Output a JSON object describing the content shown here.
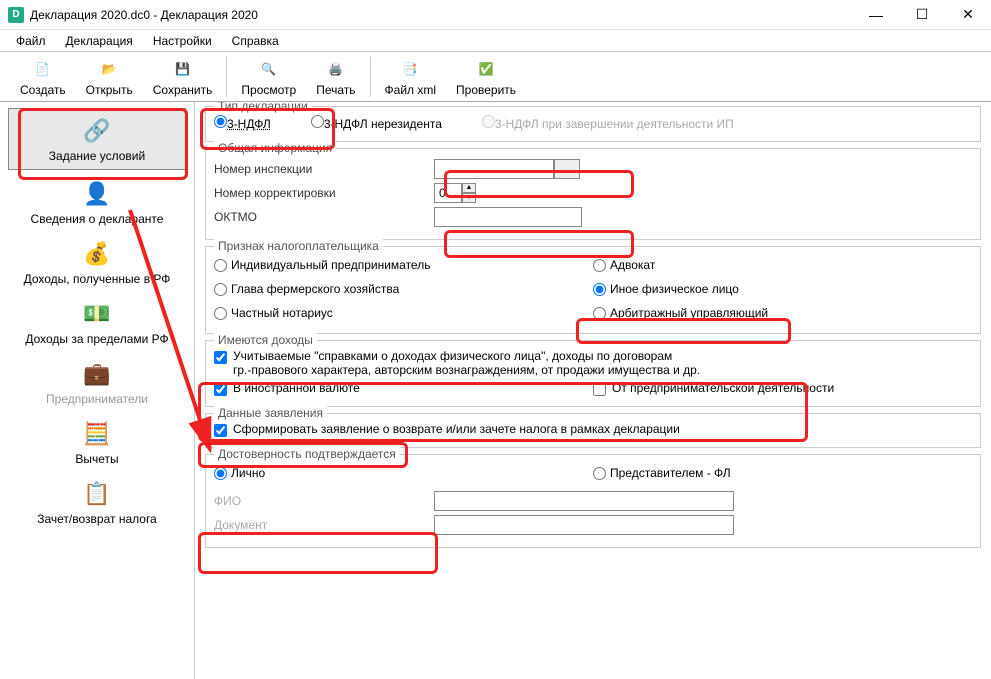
{
  "window": {
    "title": "Декларация 2020.dc0 - Декларация 2020"
  },
  "menu": {
    "file": "Файл",
    "decl": "Декларация",
    "settings": "Настройки",
    "help": "Справка"
  },
  "toolbar": {
    "create": "Создать",
    "open": "Открыть",
    "save": "Сохранить",
    "preview": "Просмотр",
    "print": "Печать",
    "xml": "Файл xml",
    "check": "Проверить"
  },
  "sidebar": {
    "s0": "Задание условий",
    "s1": "Сведения о декларанте",
    "s2": "Доходы, полученные в РФ",
    "s3": "Доходы за пределами РФ",
    "s4": "Предприниматели",
    "s5": "Вычеты",
    "s6": "Зачет/возврат налога"
  },
  "decltype": {
    "legend": "Тип декларации",
    "r1": "3-НДФЛ",
    "r2": "3-НДФЛ нерезидента",
    "r3": "3-НДФЛ при завершении деятельности ИП"
  },
  "general": {
    "legend": "Общая информация",
    "inspection": "Номер инспекции",
    "correction": "Номер корректировки",
    "correction_val": "0",
    "oktmo": "ОКТМО"
  },
  "taxpayer": {
    "legend": "Признак налогоплательщика",
    "r1": "Индивидуальный предприниматель",
    "r2": "Адвокат",
    "r3": "Глава фермерского хозяйства",
    "r4": "Иное физическое лицо",
    "r5": "Частный нотариус",
    "r6": "Арбитражный управляющий"
  },
  "income": {
    "legend": "Имеются доходы",
    "c1a": "Учитываемые \"справками о доходах физического лица\", доходы по договорам",
    "c1b": "гр.-правового характера, авторским вознаграждениям, от продажи имущества и др.",
    "c2": "В иностранной валюте",
    "c3": "От предпринимательской деятельности"
  },
  "statement": {
    "legend": "Данные заявления",
    "c1": "Сформировать заявление о возврате и/или зачете налога в рамках декларации"
  },
  "confirm": {
    "legend": "Достоверность подтверждается",
    "r1": "Лично",
    "r2": "Представителем - ФЛ",
    "fio": "ФИО",
    "doc": "Документ"
  }
}
